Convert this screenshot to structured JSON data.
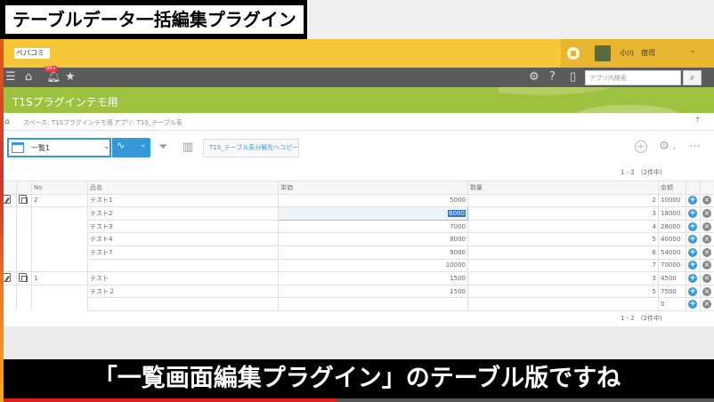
{
  "video_title": "テーブルデータ一括編集プラグイン",
  "subtitle": "「一覧画面編集プラグイン」のテーブル版ですね",
  "progress": 0.47,
  "header": {
    "logo": "ペパコミ",
    "user_name": "小川　宿司"
  },
  "toolbar": {
    "notification_badge": "99+",
    "search_placeholder": "アプリ内検索"
  },
  "app_title": "T1Sプラグインテモ用",
  "breadcrumb": {
    "space": "スペース: T1Sプラグインテモ用",
    "app": "アプリ: T1S_テーブル系"
  },
  "view": {
    "name": "一覧1",
    "copy_button": "T1S_テーブル系分解先へコピー"
  },
  "record_count_top": "1 - 2　(2件中)",
  "record_count_bottom": "1 - 2　(2件中)",
  "table": {
    "columns": [
      "No",
      "品名",
      "単価",
      "数量",
      "金額"
    ],
    "records": [
      {
        "no": "2",
        "rows": [
          {
            "name": "テスト1",
            "price": "5000",
            "qty": "2",
            "amount": "10000"
          },
          {
            "name": "テスト2",
            "price": "6000",
            "qty": "3",
            "amount": "18000",
            "selected": true
          },
          {
            "name": "テスト3",
            "price": "7000",
            "qty": "4",
            "amount": "28000"
          },
          {
            "name": "テスト4",
            "price": "8000",
            "qty": "5",
            "amount": "40000"
          },
          {
            "name": "テスト7",
            "price": "9000",
            "qty": "6",
            "amount": "54000"
          },
          {
            "name": "",
            "price": "10000",
            "qty": "7",
            "amount": "70000"
          }
        ]
      },
      {
        "no": "1",
        "rows": [
          {
            "name": "テスト",
            "price": "1500",
            "qty": "3",
            "amount": "4500"
          },
          {
            "name": "テスト２",
            "price": "1500",
            "qty": "5",
            "amount": "7500"
          },
          {
            "name": "",
            "price": "",
            "qty": "",
            "amount": "0"
          }
        ]
      }
    ]
  },
  "colors": {
    "header_yellow": "#f5c637",
    "app_green": "#9dc23f",
    "accent_blue": "#3498db"
  }
}
